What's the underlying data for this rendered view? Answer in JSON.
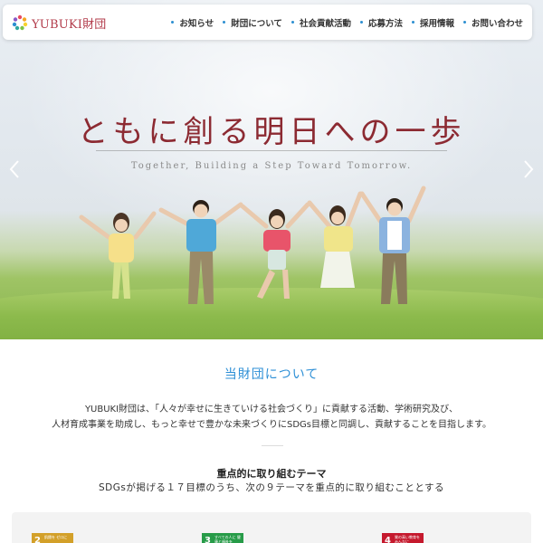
{
  "header": {
    "logo_text": "YUBUKI財団",
    "nav": [
      {
        "label": "お知らせ"
      },
      {
        "label": "財団について"
      },
      {
        "label": "社会貢献活動"
      },
      {
        "label": "応募方法"
      },
      {
        "label": "採用情報"
      },
      {
        "label": "お問い合わせ"
      }
    ]
  },
  "hero": {
    "title": "ともに創る明日への一歩",
    "subtitle": "Together, Building a Step Toward Tomorrow."
  },
  "about": {
    "title": "当財団について",
    "line1": "YUBUKI財団は、「人々が幸せに生きていける社会づくり」に貢献する活動、学術研究及び、",
    "line2": "人材育成事業を助成し、もっと幸せで豊かな未来づくりにSDGs目標と同調し、貢献することを目指します。"
  },
  "focus": {
    "title": "重点的に取り組むテーマ",
    "subtitle": "SDGsが掲げる１７目標のうち、次の９テーマを重点的に取り組むこととする"
  },
  "sdg_tiles": [
    {
      "num": "2",
      "label": "飢餓を ゼロに",
      "color": "#d3a029"
    },
    {
      "num": "3",
      "label": "すべての人に 健康と福祉を",
      "color": "#279b48"
    },
    {
      "num": "4",
      "label": "質の高い教育を みんなに",
      "color": "#c5192d"
    }
  ],
  "colors": {
    "accent": "#2d8fd6",
    "brand": "#b23b4a",
    "title": "#8c2a32"
  }
}
